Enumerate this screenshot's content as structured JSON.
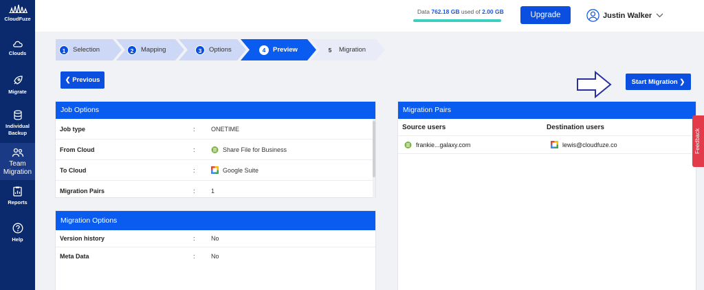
{
  "app": {
    "logo_text": "CloudFuze"
  },
  "sidebar": {
    "items": [
      {
        "label": "Clouds",
        "icon": "cloud-icon"
      },
      {
        "label": "Migrate",
        "icon": "rocket-icon"
      },
      {
        "label_line1": "Individual",
        "label_line2": "Backup",
        "icon": "database-icon"
      },
      {
        "label_line1": "Team",
        "label_line2": "Migration",
        "icon": "team-icon",
        "active": true
      },
      {
        "label": "Reports",
        "icon": "reports-icon"
      },
      {
        "label": "Help",
        "icon": "help-icon"
      }
    ]
  },
  "header": {
    "data_prefix": "Data",
    "data_used": "762.18 GB",
    "data_mid": "used of",
    "data_total": "2.00 GB",
    "usage_fraction": 1.0,
    "upgrade_label": "Upgrade",
    "user_name": "Justin Walker"
  },
  "steps": [
    {
      "num": "1",
      "label": "Selection",
      "state": "done"
    },
    {
      "num": "2",
      "label": "Mapping",
      "state": "done"
    },
    {
      "num": "3",
      "label": "Options",
      "state": "done"
    },
    {
      "num": "4",
      "label": "Preview",
      "state": "active"
    },
    {
      "num": "5",
      "label": "Migration",
      "state": "todo"
    }
  ],
  "buttons": {
    "previous": "Previous",
    "start": "Start Migration"
  },
  "job_options": {
    "title": "Job Options",
    "separator": ":",
    "rows": [
      {
        "key": "Job type",
        "value": "ONETIME"
      },
      {
        "key": "From Cloud",
        "value": "Share File for Business",
        "icon": "sharefile-icon"
      },
      {
        "key": "To Cloud",
        "value": "Google Suite",
        "icon": "google-icon"
      },
      {
        "key": "Migration Pairs",
        "value": "1"
      }
    ]
  },
  "migration_options": {
    "title": "Migration Options",
    "separator": ":",
    "rows": [
      {
        "key": "Version history",
        "value": "No"
      },
      {
        "key": "Meta Data",
        "value": "No"
      }
    ]
  },
  "migration_pairs": {
    "title": "Migration Pairs",
    "col_source": "Source users",
    "col_dest": "Destination users",
    "rows": [
      {
        "source": "frankie...galaxy.com",
        "dest": "lewis@cloudfuze.co"
      }
    ]
  },
  "feedback_label": "Feedback",
  "colors": {
    "primary": "#0a4fe0",
    "sidebar": "#0b2a6e",
    "accent": "#3ccfc0",
    "feedback": "#e43b4b"
  }
}
